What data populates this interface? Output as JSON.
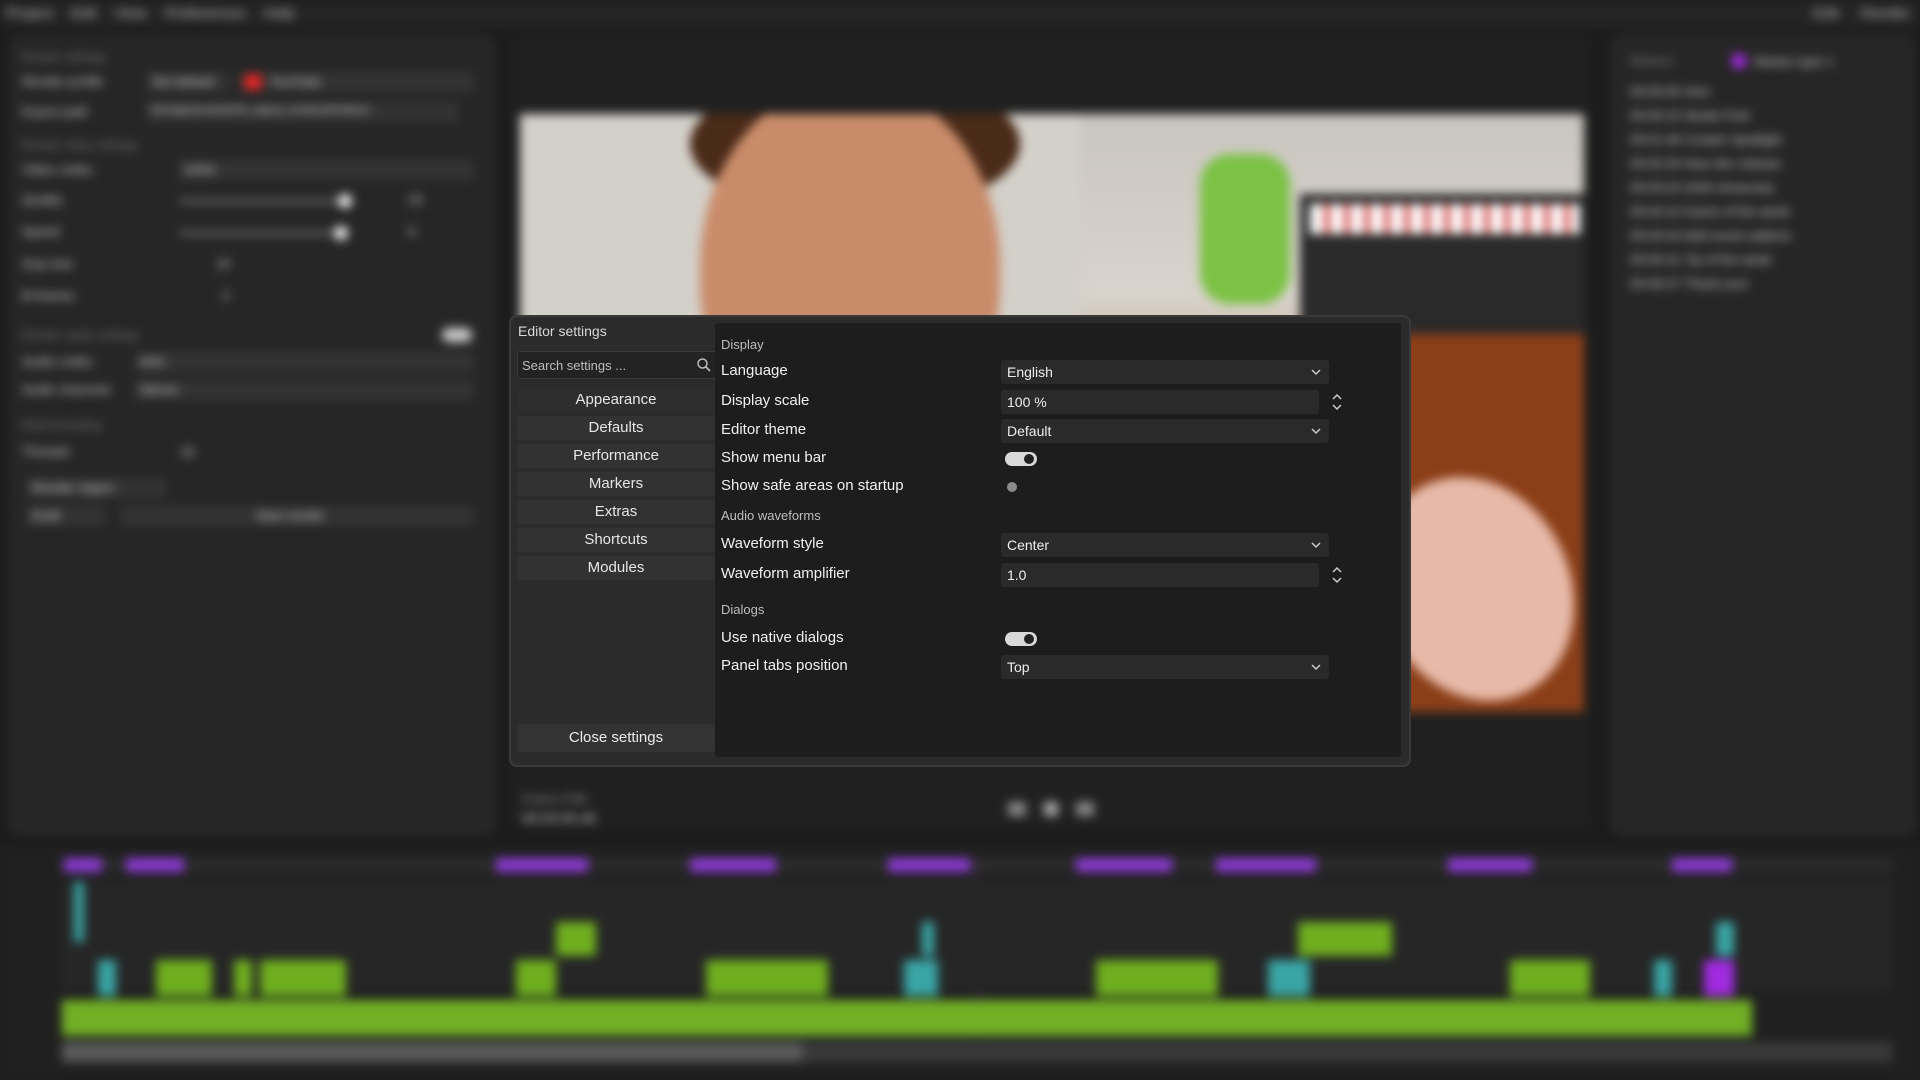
{
  "background": {
    "menu": [
      "Project",
      "Edit",
      "View",
      "Preferences",
      "Help"
    ],
    "right_menu": [
      "Edit",
      "Render"
    ],
    "render_panel": {
      "header": "Render settings",
      "profile_label": "Render profile",
      "set_default": "Set default",
      "profile_value": "YouTube",
      "export_label": "Export path",
      "export_value": "/storage/youtube/04_signal_rendered/videos/",
      "video_header": "Render video settings",
      "codec_label": "Video codec",
      "codec_value": "H264",
      "quality_label": "Quality",
      "quality_value": "23",
      "speed_label": "Speed",
      "speed_value": "6",
      "gop_label": "Gop size",
      "gop_value": "10",
      "bframes_label": "B-frames",
      "bframes_value": "2",
      "audio_header": "Render audio settings",
      "acodec_label": "Audio codec",
      "acodec_value": "AAC",
      "channels_label": "Audio channels",
      "channels_value": "Stereo",
      "mt_header": "Multi-threading",
      "threads_label": "Threads",
      "threads_value": "16",
      "region_label": "Render region",
      "draft_label": "Draft",
      "start_label": "Start render"
    },
    "transport": {
      "frame_label": "Frame 2790",
      "timecode": "00:03:45.46"
    },
    "markers_panel": {
      "header": "Markers",
      "type": "Marker type 1",
      "items": [
        "00:00:00 Intro",
        "00:00:15 Studio Feel",
        "00:01:46 Creator Spotlight",
        "00:02:34 New dev release",
        "00:03:24 2026 showcase",
        "00:04:10 Game of the week",
        "00:04:44 Add scene addons",
        "00:05:41 Tip of the week",
        "00:06:27 Thank you!"
      ]
    }
  },
  "dialog": {
    "title": "Editor settings",
    "search_placeholder": "Search settings ...",
    "nav": [
      "Appearance",
      "Defaults",
      "Performance",
      "Markers",
      "Extras",
      "Shortcuts",
      "Modules"
    ],
    "active_nav": "Appearance",
    "close_label": "Close settings",
    "sections": {
      "display": {
        "title": "Display",
        "language_label": "Language",
        "language_value": "English",
        "scale_label": "Display scale",
        "scale_value": "100 %",
        "theme_label": "Editor theme",
        "theme_value": "Default",
        "menubar_label": "Show menu bar",
        "menubar_on": true,
        "safe_label": "Show safe areas on startup",
        "safe_on": false
      },
      "waveforms": {
        "title": "Audio waveforms",
        "style_label": "Waveform style",
        "style_value": "Center",
        "amp_label": "Waveform amplifier",
        "amp_value": "1.0"
      },
      "dialogs": {
        "title": "Dialogs",
        "native_label": "Use native dialogs",
        "native_on": true,
        "tabs_label": "Panel tabs position",
        "tabs_value": "Top"
      }
    }
  },
  "colors": {
    "accent_purple": "#a12be0",
    "clip_green": "#6fae1f",
    "clip_cyan": "#3aa5a5",
    "profile_red": "#e02424"
  }
}
